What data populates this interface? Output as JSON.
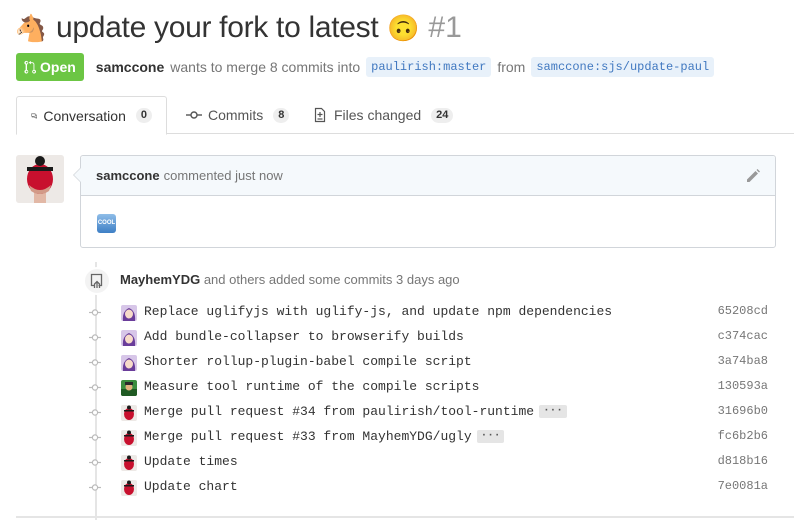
{
  "pr": {
    "title_emoji_start": "🐴",
    "title": "update your fork to latest",
    "title_emoji_end": "🙃",
    "number": "#1",
    "state": "Open",
    "author": "samccone",
    "action_text": "wants to merge 8 commits into",
    "base_branch": "paulirish:master",
    "from_text": "from",
    "head_branch": "samccone:sjs/update-paul"
  },
  "tabs": [
    {
      "label": "Conversation",
      "count": "0",
      "icon": "comment-discussion-icon"
    },
    {
      "label": "Commits",
      "count": "8",
      "icon": "git-commit-icon"
    },
    {
      "label": "Files changed",
      "count": "24",
      "icon": "diff-icon"
    }
  ],
  "comment": {
    "author": "samccone",
    "action": "commented just now",
    "body_emoji": "cool",
    "body_emoji_text": "COOL"
  },
  "push": {
    "author": "MayhemYDG",
    "text": "and others added some commits 3 days ago"
  },
  "commits": [
    {
      "message": "Replace uglifyjs with uglify-js, and update npm dependencies",
      "sha": "65208cd",
      "has_more": false,
      "avatar": "anime"
    },
    {
      "message": "Add bundle-collapser to browserify builds",
      "sha": "c374cac",
      "has_more": false,
      "avatar": "anime"
    },
    {
      "message": "Shorter rollup-plugin-babel compile script",
      "sha": "3a74ba8",
      "has_more": false,
      "avatar": "anime"
    },
    {
      "message": "Measure tool runtime of the compile scripts",
      "sha": "130593a",
      "has_more": false,
      "avatar": "green"
    },
    {
      "message": "Merge pull request #34 from paulirish/tool-runtime",
      "sha": "31696b0",
      "has_more": true,
      "avatar": "red"
    },
    {
      "message": "Merge pull request #33 from MayhemYDG/ugly",
      "sha": "fc6b2b6",
      "has_more": true,
      "avatar": "red"
    },
    {
      "message": "Update times",
      "sha": "d818b16",
      "has_more": false,
      "avatar": "red"
    },
    {
      "message": "Update chart",
      "sha": "7e0081a",
      "has_more": false,
      "avatar": "red"
    }
  ],
  "colors": {
    "open_green": "#6cc644",
    "link_blue": "#4078c0",
    "branch_bg": "#e8f1fa",
    "muted": "#767676"
  }
}
